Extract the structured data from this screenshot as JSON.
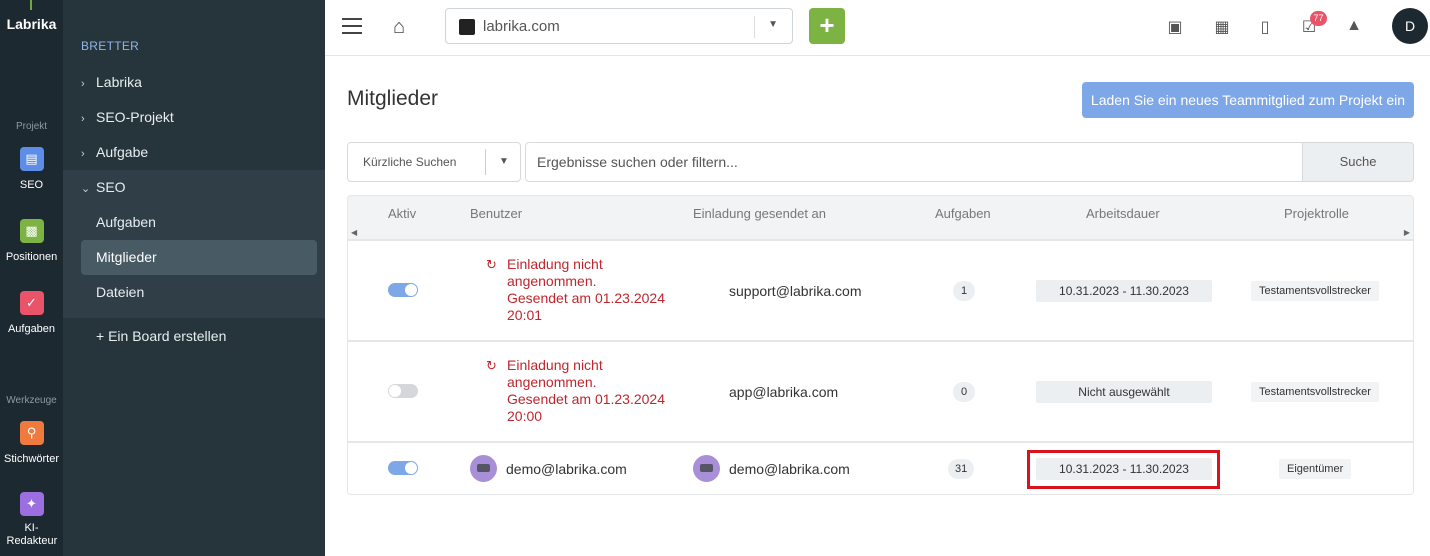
{
  "rail": {
    "logo": "Labrika",
    "section_project": "Projekt",
    "section_tools": "Werkzeuge",
    "items": [
      {
        "label": "SEO",
        "icon": "clipboard-icon",
        "color": "#5d8de6"
      },
      {
        "label": "Positionen",
        "icon": "chart-icon",
        "color": "#7cb342"
      },
      {
        "label": "Aufgaben",
        "icon": "check-icon",
        "color": "#e9546b"
      },
      {
        "label": "Stichwörter",
        "icon": "key-icon",
        "color": "#f0793e"
      },
      {
        "label": "KI-Redakteur",
        "icon": "magic-wand-icon",
        "color": "#9b6fe0"
      }
    ]
  },
  "nav": {
    "header": "BRETTER",
    "items": [
      {
        "label": "Labrika"
      },
      {
        "label": "SEO-Projekt"
      },
      {
        "label": "Aufgabe"
      },
      {
        "label": "SEO"
      }
    ],
    "sub_items": [
      {
        "label": "Aufgaben"
      },
      {
        "label": "Mitglieder"
      },
      {
        "label": "Dateien"
      }
    ],
    "create_board": "+ Ein Board erstellen"
  },
  "topbar": {
    "site": "labrika.com",
    "add_label": "+",
    "notification_badge": "77",
    "avatar_initial": "D"
  },
  "main": {
    "title": "Mitglieder",
    "invite_button": "Laden Sie ein neues Teammitglied zum Projekt ein",
    "recent_searches": "Kürzliche Suchen",
    "search_placeholder": "Ergebnisse suchen oder filtern...",
    "search_button": "Suche"
  },
  "table": {
    "headers": [
      "Aktiv",
      "Benutzer",
      "Einladung gesendet an",
      "Aufgaben",
      "Arbeitsdauer",
      "Projektrolle"
    ],
    "rows": [
      {
        "active": true,
        "user_status_line1": "Einladung nicht",
        "user_status_line2": "angenommen.",
        "user_status_line3": "Gesendet am 01.23.2024",
        "user_status_line4": "20:01",
        "invited_to": "support@labrika.com",
        "tasks": "1",
        "duration": "10.31.2023 - 11.30.2023",
        "role": "Testamentsvollstrecker"
      },
      {
        "active": false,
        "user_status_line1": "Einladung nicht",
        "user_status_line2": "angenommen.",
        "user_status_line3": "Gesendet am 01.23.2024",
        "user_status_line4": "20:00",
        "invited_to": "app@labrika.com",
        "tasks": "0",
        "duration": "Nicht ausgewählt",
        "role": "Testamentsvollstrecker"
      },
      {
        "active": true,
        "user": "demo@labrika.com",
        "invited_to": "demo@labrika.com",
        "tasks": "31",
        "duration": "10.31.2023 - 11.30.2023",
        "role": "Eigentümer"
      }
    ]
  },
  "colors": {
    "rail_bg": "#1d2930",
    "nav_bg": "#26343c",
    "accent_blue": "#7ea7e8",
    "add_green": "#7cb342",
    "pending_red": "#c0262d",
    "highlight_red": "#d8131d"
  }
}
